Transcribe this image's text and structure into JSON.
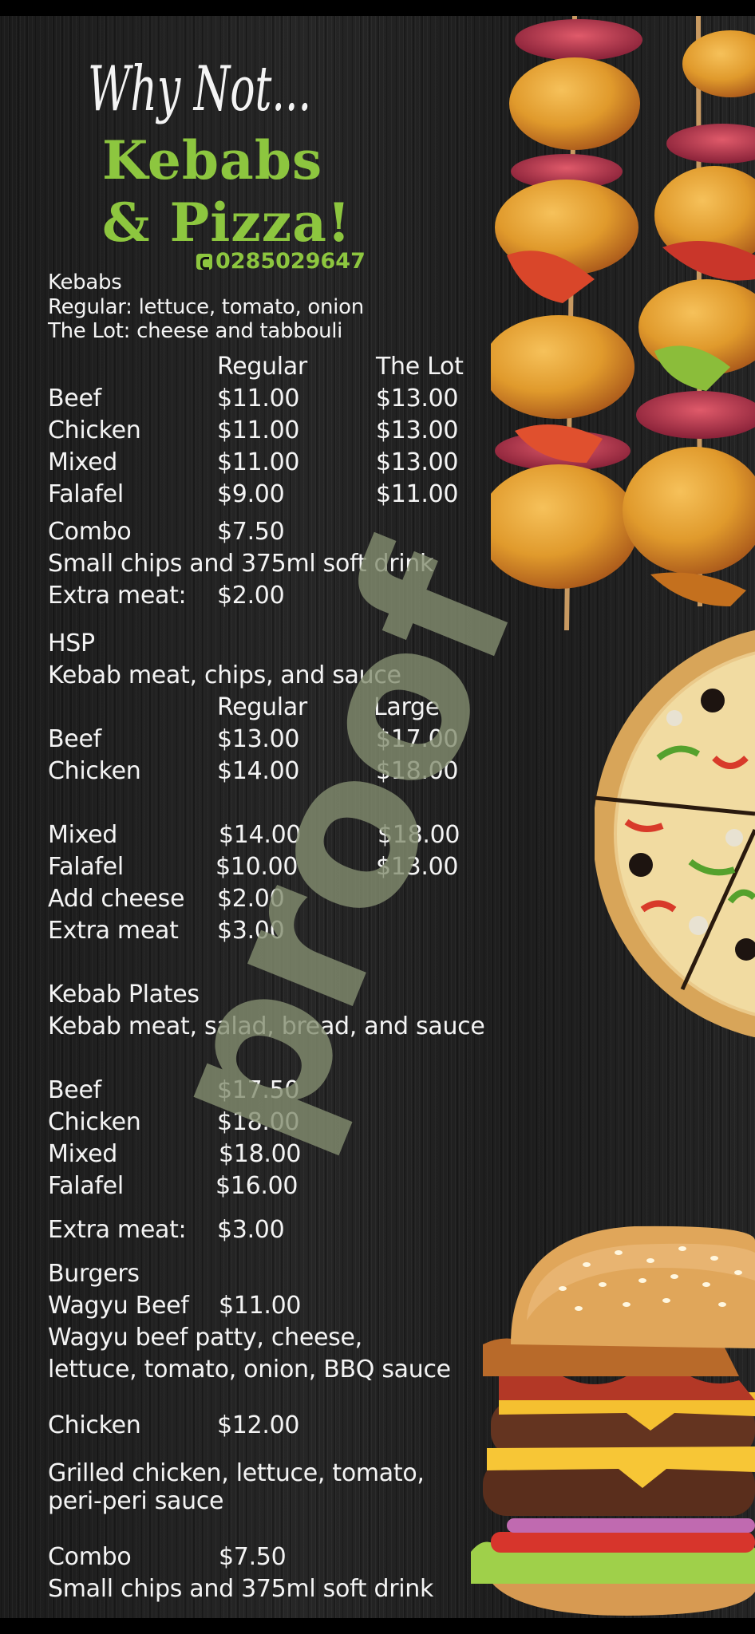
{
  "header": {
    "script_title": "Why Not...",
    "brand_line1": "Kebabs",
    "brand_line2": "& Pizza!",
    "phone": "0285029647",
    "phone_icon": "phone-icon"
  },
  "colors": {
    "accent": "#8dc63f",
    "watermark": "#848e70",
    "background": "#1e1e1e",
    "text": "#f4f4f4"
  },
  "watermark": "proof",
  "kebabs": {
    "title": "Kebabs",
    "desc1": "Regular: lettuce, tomato, onion",
    "desc2": "The Lot: cheese and tabbouli",
    "col1": "Regular",
    "col2": "The Lot",
    "items": [
      {
        "name": "Beef",
        "p1": "$11.00",
        "p2": "$13.00"
      },
      {
        "name": "Chicken",
        "p1": "$11.00",
        "p2": "$13.00"
      },
      {
        "name": "Mixed",
        "p1": "$11.00",
        "p2": "$13.00"
      },
      {
        "name": "Falafel",
        "p1": "$9.00",
        "p2": "$11.00"
      }
    ],
    "combo_label": "Combo",
    "combo_price": "$7.50",
    "combo_desc": "Small chips and 375ml soft drink",
    "extra_label": "Extra meat:",
    "extra_price": "$2.00"
  },
  "hsp": {
    "title": "HSP",
    "desc": "Kebab meat, chips, and sauce",
    "col1": "Regular",
    "col2": "Large",
    "items": [
      {
        "name": "Beef",
        "p1": "$13.00",
        "p2": "$17.00"
      },
      {
        "name": "Chicken",
        "p1": "$14.00",
        "p2": "$18.00"
      },
      {
        "name": "Mixed",
        "p1": "$14.00",
        "p2": "$18.00"
      },
      {
        "name": "Falafel",
        "p1": "$10.00",
        "p2": "$13.00"
      }
    ],
    "cheese_label": "Add cheese",
    "cheese_price": "$2.00",
    "extra_label": "Extra meat",
    "extra_price": "$3.00"
  },
  "plates": {
    "title": "Kebab Plates",
    "desc": "Kebab meat, salad, bread, and sauce",
    "items": [
      {
        "name": "Beef",
        "price": "$17.50"
      },
      {
        "name": "Chicken",
        "price": "$18.00"
      },
      {
        "name": "Mixed",
        "price": "$18.00"
      },
      {
        "name": "Falafel",
        "price": "$16.00"
      }
    ],
    "extra_label": "Extra meat:",
    "extra_price": "$3.00"
  },
  "burgers": {
    "title": "Burgers",
    "wagyu_name": "Wagyu Beef",
    "wagyu_price": "$11.00",
    "wagyu_desc1": "Wagyu beef patty, cheese,",
    "wagyu_desc2": "lettuce, tomato, onion, BBQ sauce",
    "chicken_name": "Chicken",
    "chicken_price": "$12.00",
    "chicken_desc1": "Grilled chicken, lettuce, tomato,",
    "chicken_desc2": "peri-peri sauce",
    "combo_label": "Combo",
    "combo_price": "$7.50",
    "combo_desc": "Small chips and 375ml soft drink"
  },
  "images": {
    "skewers": "kebab-skewers-image",
    "pizza": "pizza-image",
    "burger": "burger-image"
  }
}
